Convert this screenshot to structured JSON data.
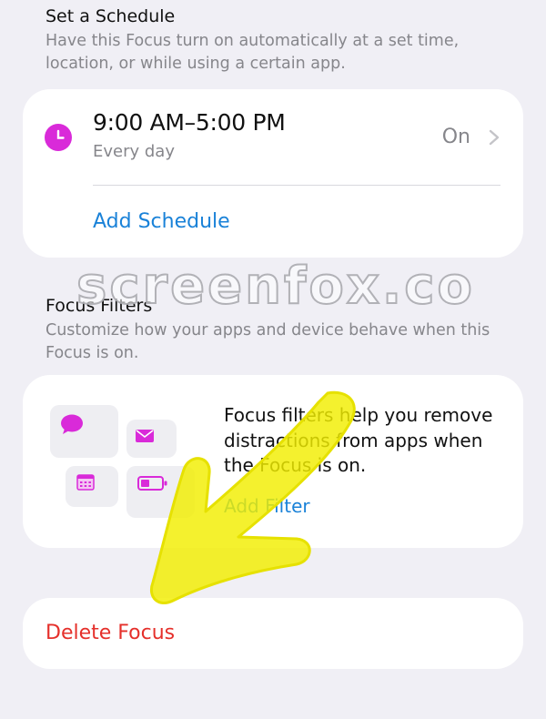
{
  "schedule_section": {
    "title": "Set a Schedule",
    "description": "Have this Focus turn on automatically at a set time, location, or while using a certain app."
  },
  "schedule_card": {
    "time_range": "9:00 AM–5:00 PM",
    "repeat": "Every day",
    "status": "On",
    "add_schedule": "Add Schedule",
    "icon": "clock-icon"
  },
  "filters_section": {
    "title": "Focus Filters",
    "description": "Customize how your apps and device behave when this Focus is on."
  },
  "filters_card": {
    "text": "Focus filters help you remove distractions from apps when the Focus is on.",
    "add_filter": "Add Filter",
    "icons": [
      "message-icon",
      "mail-icon",
      "calendar-icon",
      "battery-icon"
    ]
  },
  "delete_card": {
    "label": "Delete Focus"
  },
  "watermark": "screenfox.co",
  "colors": {
    "background": "#f0eff5",
    "accent_purple": "#d92ad9",
    "link_blue": "#1a82d8",
    "delete_red": "#e5302b",
    "arrow_yellow": "#f2ee00"
  }
}
